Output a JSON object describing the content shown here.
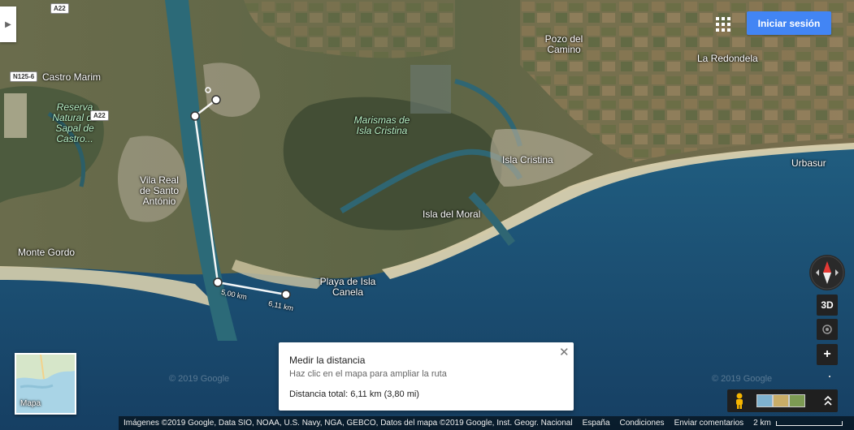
{
  "places": [
    {
      "name": "Castro Marim",
      "style": "white"
    },
    {
      "name": "Reserva Natural do Sapal de Castro...",
      "style": "green"
    },
    {
      "name": "Vila Real de Santo António",
      "style": "white"
    },
    {
      "name": "Monte Gordo",
      "style": "white"
    },
    {
      "name": "Marismas de Isla Cristina",
      "style": "green"
    },
    {
      "name": "Pozo del Camino",
      "style": "white"
    },
    {
      "name": "La Redondela",
      "style": "white"
    },
    {
      "name": "Isla Cristina",
      "style": "white"
    },
    {
      "name": "Urbasur",
      "style": "white"
    },
    {
      "name": "Isla del Moral",
      "style": "white"
    },
    {
      "name": "Playa de Isla Canela",
      "style": "white"
    }
  ],
  "road_signs": [
    "A22",
    "N125-6",
    "A22"
  ],
  "measurement": {
    "segment_labels": [
      "5,00 km",
      "6,11 km"
    ],
    "card_title": "Medir la distancia",
    "card_subtitle": "Haz clic en el mapa para ampliar la ruta",
    "total": "Distancia total: 6,11 km (3,80 mi)",
    "close_glyph": "✕"
  },
  "header": {
    "signin_label": "Iniciar sesión",
    "apps_icon": "apps-grid-icon",
    "sidebar_icon": "chevron-right-icon",
    "sidebar_glyph": "▶"
  },
  "controls": {
    "tilt_label": "3D",
    "zoom_in_label": "+",
    "compass_icon": "compass-icon",
    "location_icon": "my-location-icon"
  },
  "layer": {
    "label": "Mapa"
  },
  "watermark": "© 2019 Google",
  "footer": {
    "attribution": "Imágenes ©2019 Google, Data SIO, NOAA, U.S. Navy, NGA, GEBCO, Datos del mapa ©2019 Google, Inst. Geogr. Nacional",
    "country": "España",
    "terms": "Condiciones",
    "feedback": "Enviar comentarios",
    "scale": "2 km"
  },
  "colors": {
    "sea_deep": "#1b4f73",
    "sea_shallow": "#3a7d8f",
    "land": "#5e6a48",
    "accent": "#4285f4"
  }
}
